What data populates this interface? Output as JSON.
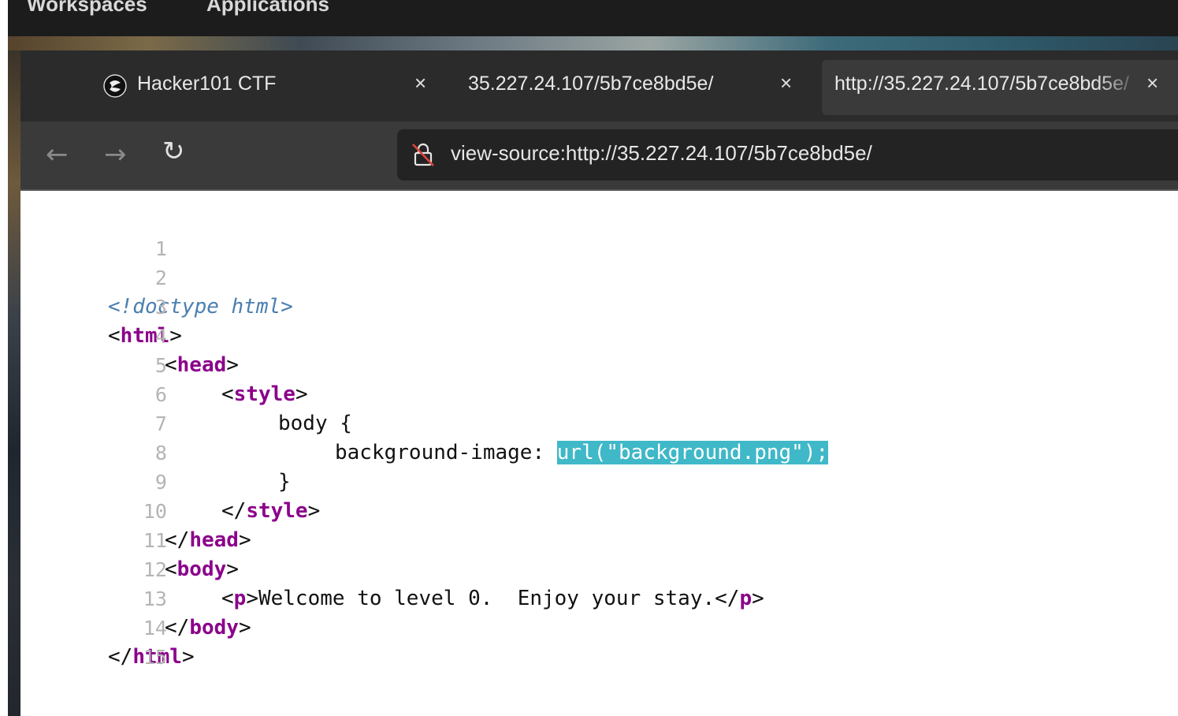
{
  "topbar": {
    "workspaces": "Workspaces",
    "applications": "Applications"
  },
  "tabs": [
    {
      "title": "Hacker101 CTF",
      "icon": "hacker101-logo-icon",
      "close": "×"
    },
    {
      "title": "35.227.24.107/5b7ce8bd5e/",
      "close": "×"
    },
    {
      "title": "http://35.227.24.107/5b7ce8bd5e/",
      "close": "×",
      "active": true
    }
  ],
  "nav": {
    "back": "←",
    "forward": "→",
    "reload": "↻",
    "url": "view-source:http://35.227.24.107/5b7ce8bd5e/",
    "lock_icon": "insecure-lock-icon"
  },
  "source": {
    "line_numbers": [
      "1",
      "2",
      "3",
      "4",
      "5",
      "6",
      "7",
      "8",
      "9",
      "10",
      "11",
      "12",
      "13",
      "14",
      "15"
    ],
    "l2": "<!doctype html>",
    "l3": {
      "open": "<",
      "tag": "html",
      "close": ">"
    },
    "l4": {
      "open": "<",
      "tag": "head",
      "close": ">"
    },
    "l5": {
      "open": "<",
      "tag": "style",
      "close": ">"
    },
    "l6": "body {",
    "l7": {
      "text": "background-image: ",
      "highlight": "url(\"background.png\");"
    },
    "l8": "}",
    "l9": {
      "open": "</",
      "tag": "style",
      "close": ">"
    },
    "l10": {
      "open": "</",
      "tag": "head",
      "close": ">"
    },
    "l11": {
      "open": "<",
      "tag": "body",
      "close": ">"
    },
    "l12": {
      "open1": "<",
      "tag1": "p",
      "close1": ">",
      "text": "Welcome to level 0.  Enjoy your stay.",
      "open2": "</",
      "tag2": "p",
      "close2": ">"
    },
    "l13": {
      "open": "</",
      "tag": "body",
      "close": ">"
    },
    "l14": {
      "open": "</",
      "tag": "html",
      "close": ">"
    }
  },
  "colors": {
    "highlight": "#3fb8c8",
    "tag": "#8b008b",
    "doctype": "#4a7fb0"
  }
}
